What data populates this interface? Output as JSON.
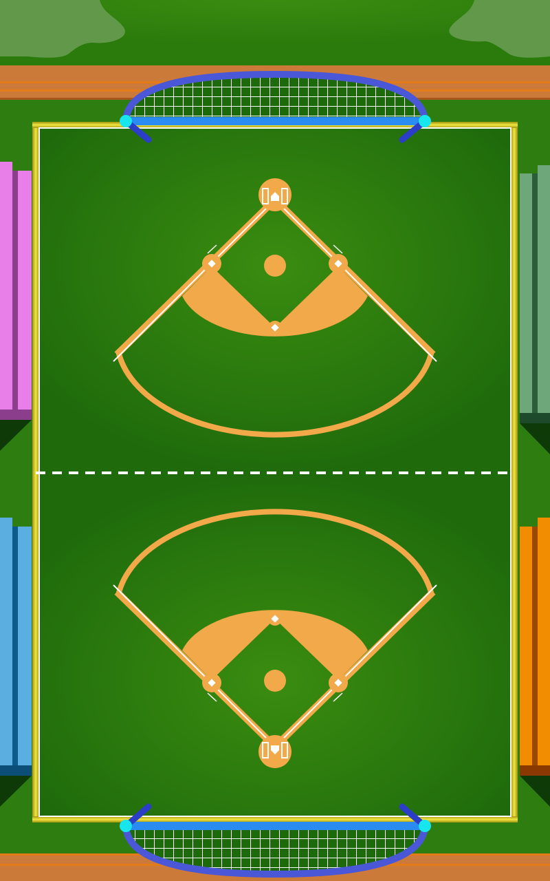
{
  "scene": {
    "type": "two-diamond baseball-style table field, top-down view",
    "goals": [
      "top-goal",
      "bottom-goal"
    ],
    "halves": [
      "top-half",
      "bottom-half"
    ],
    "stands": [
      {
        "id": "left-top",
        "color": "#e87fe8"
      },
      {
        "id": "left-bottom",
        "color": "#5aaee0"
      },
      {
        "id": "right-top",
        "color": "#6ea87a"
      },
      {
        "id": "right-bottom",
        "color": "#f28c00"
      }
    ]
  },
  "colors": {
    "grass_dark": "#1f6b0c",
    "grass_light": "#3a8c10",
    "dirt": "#f2a94a",
    "fence": "#c9b818",
    "goal_frame": "#4a57d6",
    "goal_post": "#18e6ee",
    "track": "#cc7a3a",
    "trees": "#61984a",
    "chalk": "#ffffff"
  }
}
